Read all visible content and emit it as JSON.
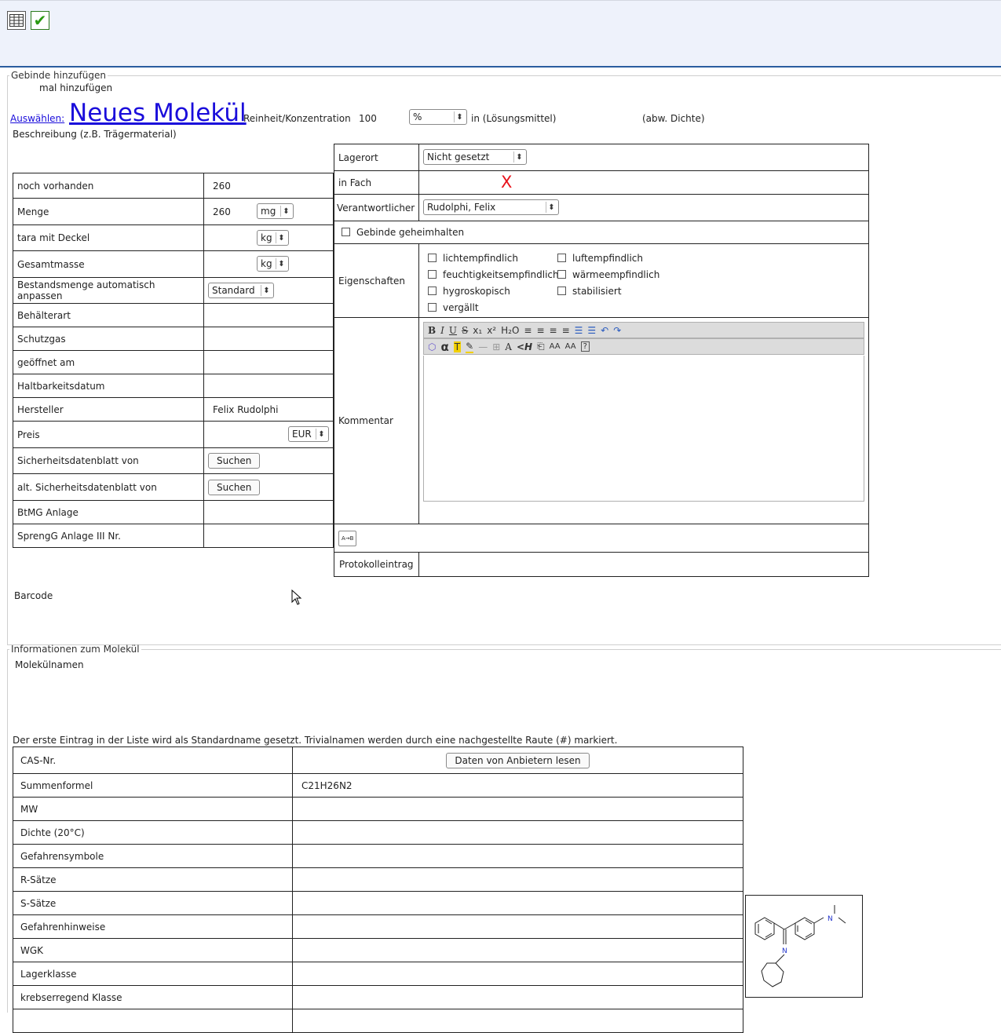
{
  "toolbar": {
    "grid_icon": "table-grid-icon",
    "check_icon": "checkmark-icon",
    "check_glyph": "✔"
  },
  "gebinde": {
    "legend": "Gebinde hinzufügen",
    "mal_hinzufuegen": "mal hinzufügen",
    "auswaehlen": "Auswählen:",
    "molecule_title": "Neues Molekül",
    "reinheit_label": "Reinheit/Konzentration",
    "reinheit_value": "100",
    "unit_select": "%",
    "loesungsmittel": "in (Lösungsmittel)",
    "abw_dichte": "(abw. Dichte)",
    "beschreibung": "Beschreibung (z.B. Trägermaterial)",
    "barcode": "Barcode"
  },
  "left_table": {
    "noch_vorhanden": {
      "label": "noch vorhanden",
      "value": "260"
    },
    "menge": {
      "label": "Menge",
      "value": "260",
      "unit": "mg"
    },
    "tara": {
      "label": "tara mit Deckel",
      "unit": "kg"
    },
    "gesamtmasse": {
      "label": "Gesamtmasse",
      "unit": "kg"
    },
    "bestand": {
      "label": "Bestandsmenge automatisch anpassen",
      "select": "Standard"
    },
    "behaelterart": {
      "label": "Behälterart"
    },
    "schutzgas": {
      "label": "Schutzgas"
    },
    "geoeffnet": {
      "label": "geöffnet am"
    },
    "haltbarkeit": {
      "label": "Haltbarkeitsdatum"
    },
    "hersteller": {
      "label": "Hersteller",
      "value": "Felix Rudolphi"
    },
    "preis": {
      "label": "Preis",
      "currency": "EUR"
    },
    "sdb": {
      "label": "Sicherheitsdatenblatt von",
      "button": "Suchen"
    },
    "alt_sdb": {
      "label": "alt. Sicherheitsdatenblatt von",
      "button": "Suchen"
    },
    "btmg": {
      "label": "BtMG Anlage"
    },
    "spreng": {
      "label": "SprengG Anlage III Nr."
    }
  },
  "right_table": {
    "lagerort": {
      "label": "Lagerort",
      "select": "Nicht gesetzt"
    },
    "in_fach": {
      "label": "in Fach",
      "value": "X"
    },
    "verantwortlicher": {
      "label": "Verantwortlicher",
      "select": "Rudolphi, Felix"
    },
    "geheim": "Gebinde geheimhalten",
    "eigenschaften": {
      "label": "Eigenschaften",
      "items": [
        "lichtempfindlich",
        "luftempfindlich",
        "feuchtigkeitsempfindlich",
        "wärmeempfindlich",
        "hygroskopisch",
        "stabilisiert",
        "vergällt"
      ]
    },
    "kommentar": "Kommentar",
    "editor_row1": [
      "B",
      "I",
      "U",
      "S",
      "x₁",
      "x²",
      "H₂O",
      "≡",
      "≡",
      "≡",
      "≡",
      "☰",
      "☰",
      "↶",
      "↷"
    ],
    "editor_row2": [
      "⬡",
      "α",
      "T",
      "✎",
      "—",
      "⊞",
      "A",
      "<H",
      "⎗",
      "AA",
      "AA",
      "?"
    ],
    "ab_button": "A→B",
    "protokoll": "Protokolleintrag"
  },
  "molekuel": {
    "legend": "Informationen zum Molekül",
    "namen": "Molekülnamen",
    "hinweis": "Der erste Eintrag in der Liste wird als Standardname gesetzt. Trivialnamen werden durch eine nachgestellte Raute (#) markiert.",
    "rows": {
      "cas": {
        "label": "CAS-Nr.",
        "button": "Daten von Anbietern lesen"
      },
      "summenformel": {
        "label": "Summenformel",
        "value": "C21H26N2"
      },
      "mw": {
        "label": "MW"
      },
      "dichte": {
        "label": "Dichte (20°C)"
      },
      "gefahrensymbole": {
        "label": "Gefahrensymbole"
      },
      "r_saetze": {
        "label": "R-Sätze"
      },
      "s_saetze": {
        "label": "S-Sätze"
      },
      "gefahrenhinweise": {
        "label": "Gefahrenhinweise"
      },
      "wgk": {
        "label": "WGK"
      },
      "lagerklasse": {
        "label": "Lagerklasse"
      },
      "krebs": {
        "label": "krebserregend Klasse"
      }
    },
    "structure_atoms": {
      "n_amine": "N",
      "n_imine": "N"
    }
  }
}
